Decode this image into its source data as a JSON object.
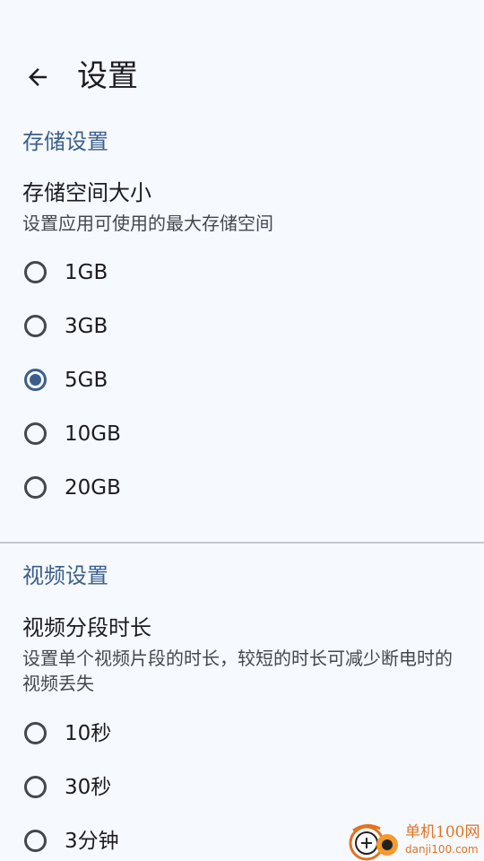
{
  "header": {
    "back_icon": "arrow-left-icon",
    "title": "设置"
  },
  "storage_section": {
    "header": "存储设置",
    "pref_title": "存储空间大小",
    "pref_summary": "设置应用可使用的最大存储空间",
    "options": [
      {
        "label": "1GB",
        "checked": false
      },
      {
        "label": "3GB",
        "checked": false
      },
      {
        "label": "5GB",
        "checked": true
      },
      {
        "label": "10GB",
        "checked": false
      },
      {
        "label": "20GB",
        "checked": false
      }
    ]
  },
  "video_section": {
    "header": "视频设置",
    "pref_title": "视频分段时长",
    "pref_summary": "设置单个视频片段的时长，较短的时长可减少断电时的视频丢失",
    "options": [
      {
        "label": "10秒",
        "checked": false
      },
      {
        "label": "30秒",
        "checked": false
      },
      {
        "label": "3分钟",
        "checked": false
      }
    ]
  },
  "watermark": {
    "brand": "单机100网",
    "domain": "danji100.com"
  },
  "colors": {
    "background": "#f6f9fe",
    "accent": "#3b5f8c",
    "text_primary": "#1c1c20",
    "text_secondary": "#44474e",
    "divider": "#c4c6cf",
    "watermark": "#e37222"
  }
}
